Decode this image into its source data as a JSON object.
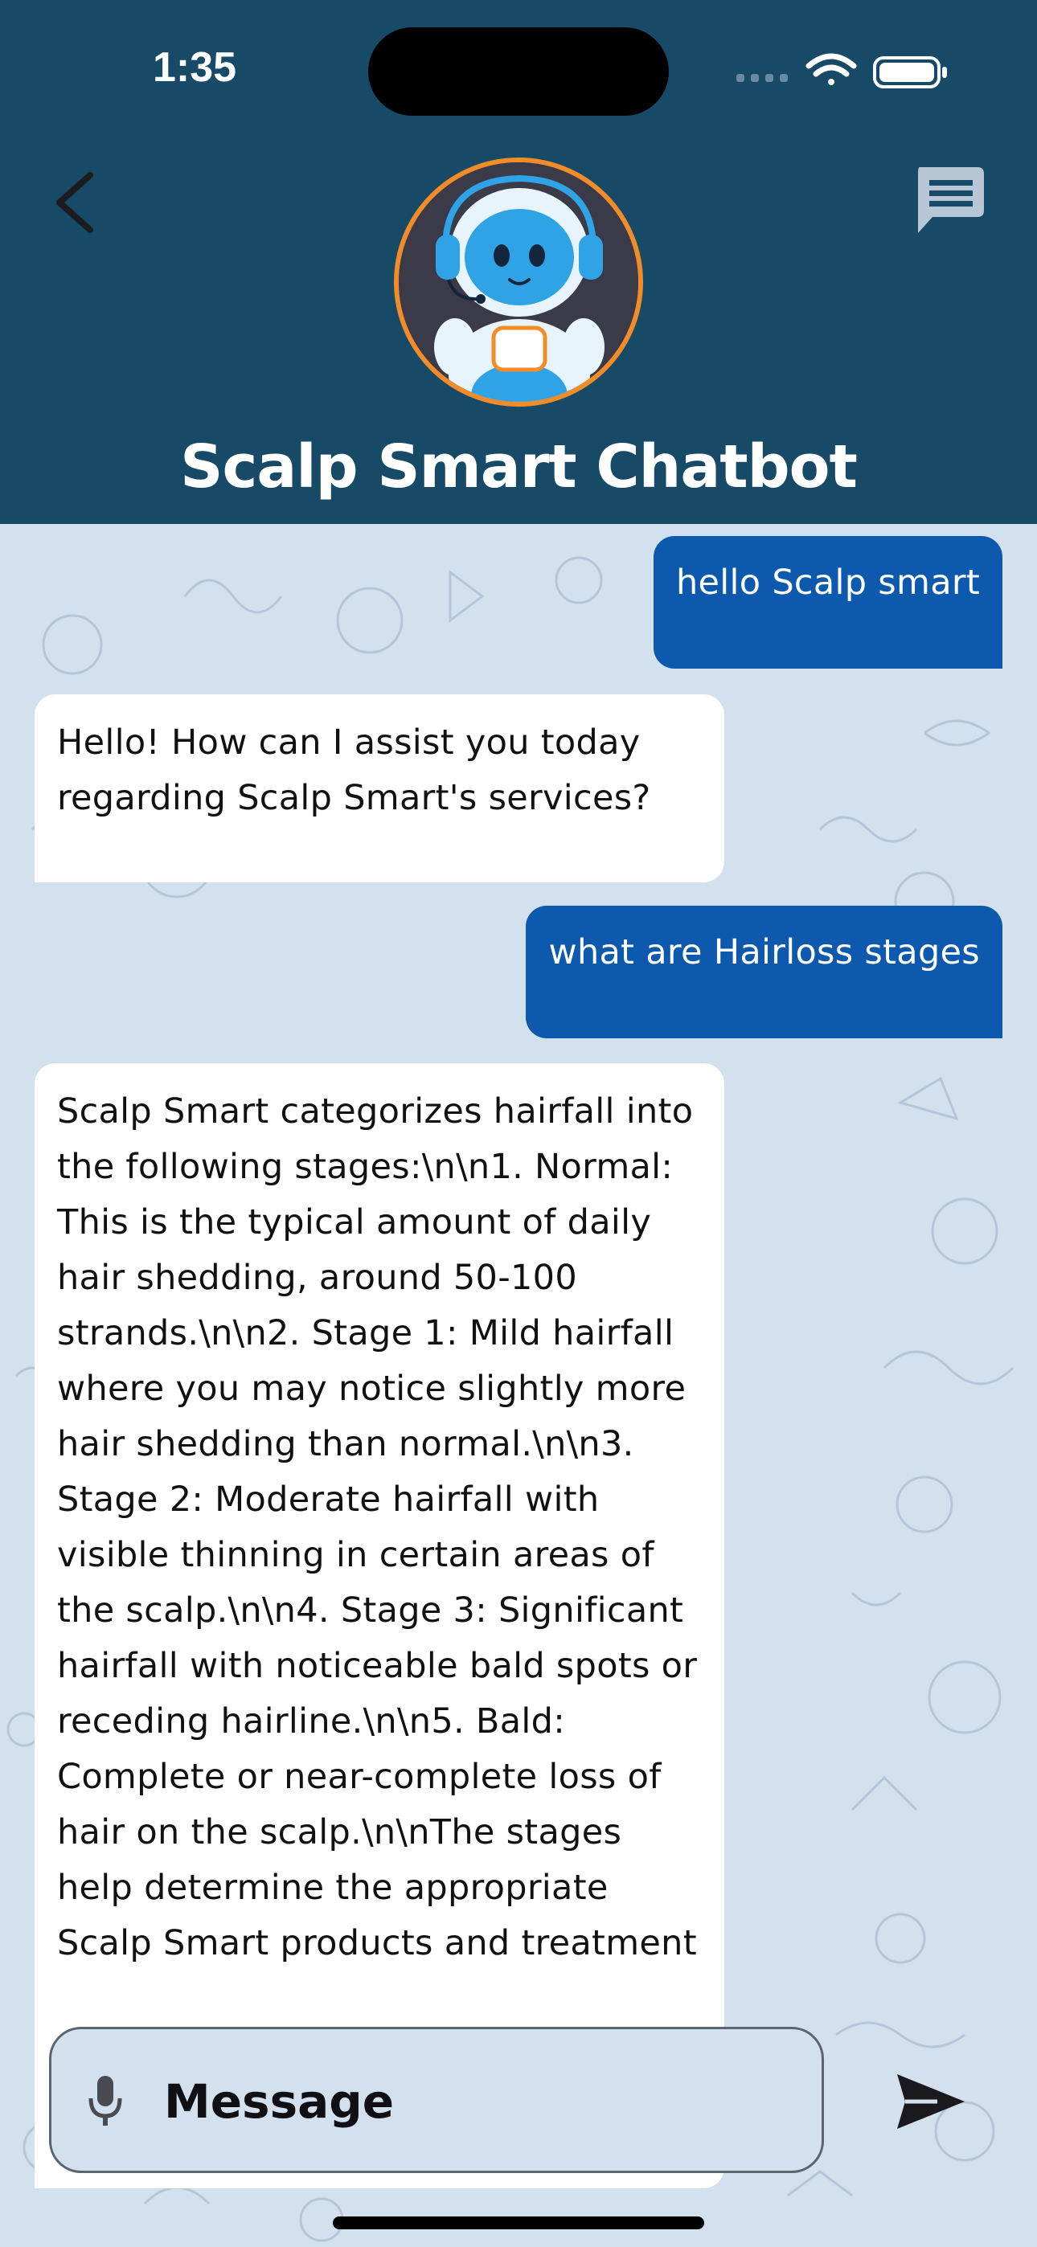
{
  "status_bar": {
    "time": "1:35",
    "icons": [
      "cellular-signal-icon",
      "wifi-icon",
      "battery-icon"
    ]
  },
  "header": {
    "title": "Scalp Smart Chatbot",
    "back_icon": "chevron-left-icon",
    "chat_icon": "message-icon",
    "avatar": "robot-assistant-avatar"
  },
  "messages": [
    {
      "role": "user",
      "text": "hello Scalp smart"
    },
    {
      "role": "bot",
      "text": "Hello! How can I assist you today regarding Scalp Smart's services?"
    },
    {
      "role": "user",
      "text": "what are Hairloss stages"
    },
    {
      "role": "bot",
      "text": "Scalp Smart categorizes hairfall into the following stages:\\n\\n1. Normal: This is the typical amount of daily hair shedding, around 50-100 strands.\\n\\n2. Stage 1: Mild hairfall where you may notice slightly more hair shedding than normal.\\n\\n3. Stage 2: Moderate hairfall with visible thinning in certain areas of the scalp.\\n\\n4. Stage 3: Significant hairfall with noticeable bald spots or receding hairline.\\n\\n5. Bald: Complete or near-complete loss of hair on the scalp.\\n\\nThe stages help determine the appropriate Scalp Smart products and treatment"
    }
  ],
  "composer": {
    "placeholder": "Message",
    "mic_icon": "microphone-icon",
    "send_icon": "send-icon"
  },
  "colors": {
    "header_bg": "#174a66",
    "chat_bg": "#d3e0ee",
    "user_bubble": "#0c59ad",
    "bot_bubble": "#ffffff",
    "avatar_ring": "#f28c28"
  }
}
